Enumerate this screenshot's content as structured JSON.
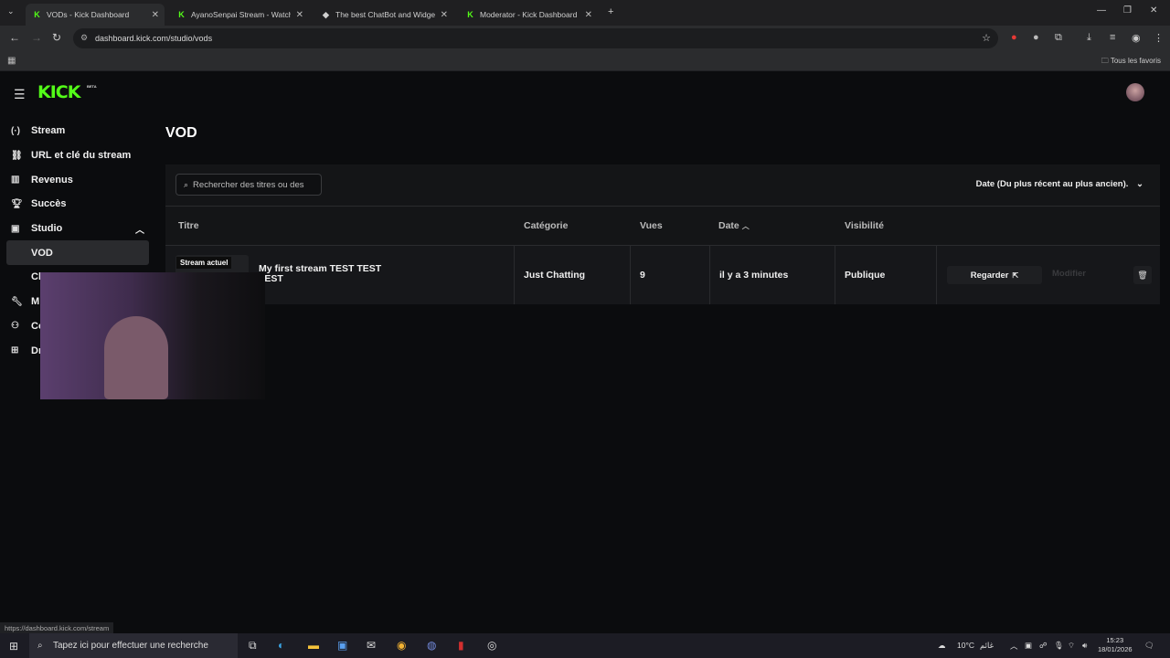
{
  "browser": {
    "tabs": [
      {
        "title": "VODs - Kick Dashboard",
        "favicon": "kick-icon",
        "active": true
      },
      {
        "title": "AyanoSenpai Stream - Watch L",
        "favicon": "kick-icon",
        "active": false
      },
      {
        "title": "The best ChatBot and Widgets",
        "favicon": "botrix-icon",
        "active": false
      },
      {
        "title": "Moderator - Kick Dashboard",
        "favicon": "kick-icon",
        "active": false
      }
    ],
    "url": "dashboard.kick.com/studio/vods",
    "bookmarks_label": "Tous les favoris",
    "status_url": "https://dashboard.kick.com/stream"
  },
  "app": {
    "logo": "KICK",
    "beta": "BETA"
  },
  "sidebar": {
    "items": [
      {
        "label": "Stream",
        "icon": "broadcast-icon"
      },
      {
        "label": "URL et clé du stream",
        "icon": "link-icon"
      },
      {
        "label": "Revenus",
        "icon": "chart-icon"
      },
      {
        "label": "Succès",
        "icon": "trophy-icon"
      },
      {
        "label": "Studio",
        "icon": "film-icon"
      },
      {
        "label": "VOD",
        "icon": ""
      },
      {
        "label": "Cl",
        "icon": ""
      },
      {
        "label": "M",
        "icon": "wrench-icon"
      },
      {
        "label": "Co",
        "icon": "users-icon"
      },
      {
        "label": "Dr",
        "icon": "cake-icon"
      }
    ]
  },
  "main": {
    "title": "VOD",
    "search_placeholder": "Rechercher des titres ou des",
    "sort_label": "Date (Du plus récent au plus ancien).",
    "columns": [
      "Titre",
      "Catégorie",
      "Vues",
      "Date",
      "Visibilité"
    ],
    "rows": [
      {
        "badge": "Stream actuel",
        "title": "My first stream TEST TEST TEST",
        "category": "Just Chatting",
        "views": "9",
        "date": "il y a 3 minutes",
        "visibility": "Publique",
        "watch": "Regarder",
        "edit": "Modifier"
      }
    ]
  },
  "taskbar": {
    "search": "Tapez ici pour effectuer une recherche",
    "weather": "10°C",
    "weather_label": "غائم",
    "time": "15:23",
    "date": "18/01/2026"
  }
}
